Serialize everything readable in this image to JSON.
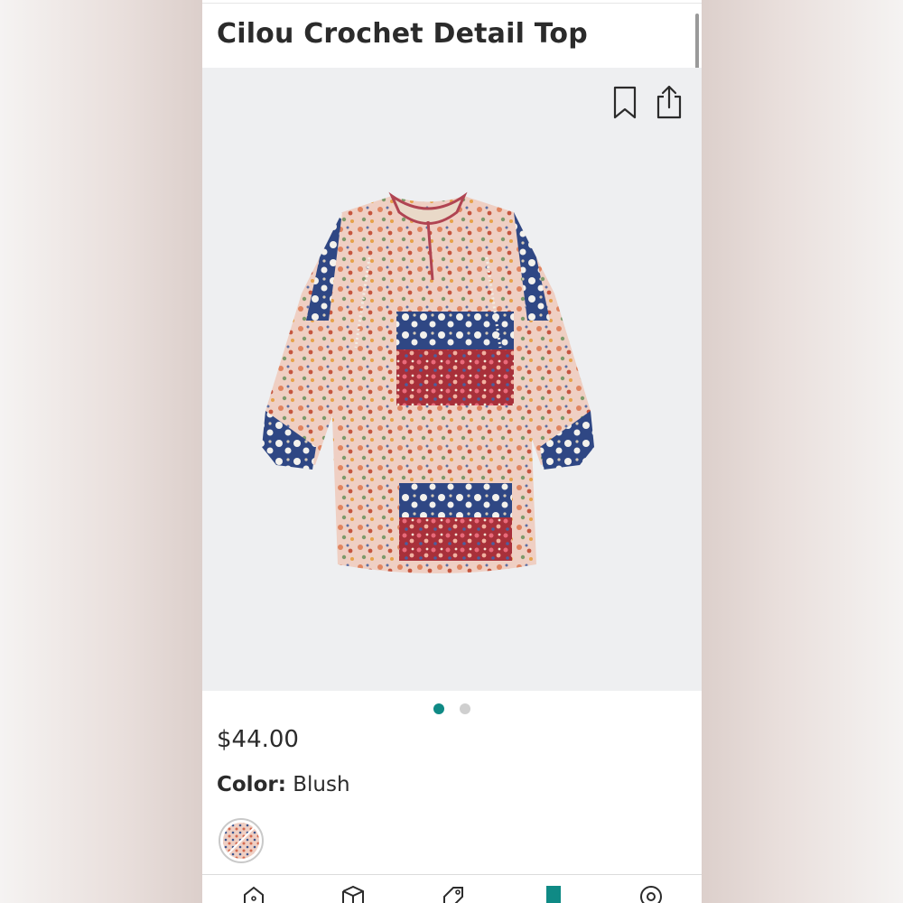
{
  "product": {
    "title": "Cilou Crochet Detail Top",
    "price": "$44.00",
    "color_label": "Color:",
    "color_value": "Blush"
  },
  "gallery": {
    "dots": [
      {
        "active": true
      },
      {
        "active": false
      }
    ]
  },
  "icons": {
    "bookmark": "bookmark-icon",
    "share": "share-icon",
    "tabs": [
      "home-icon",
      "box-icon",
      "tag-icon",
      "active-tab-icon",
      "profile-icon"
    ]
  },
  "colors": {
    "accent": "#0f8a85",
    "image_bg": "#eeeff1",
    "text": "#2b2b2b"
  }
}
